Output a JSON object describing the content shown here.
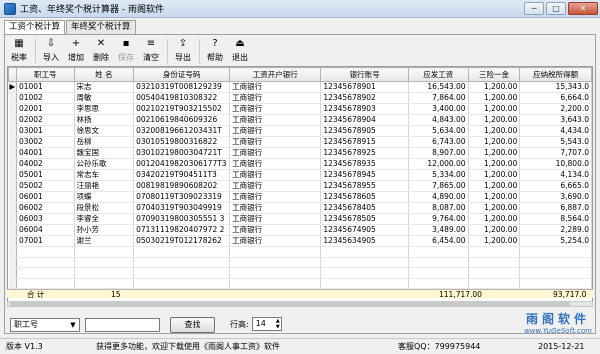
{
  "window": {
    "title": "工资、年终奖个税计算器 - 雨阁软件"
  },
  "tabs": [
    {
      "label": "工资个税计算",
      "active": true
    },
    {
      "label": "年终奖个税计算",
      "active": false
    }
  ],
  "toolbar": {
    "items": [
      {
        "label": "税率",
        "icon": "tax-rate-icon",
        "glyph": "▦",
        "disabled": false
      },
      {
        "label": "导入",
        "icon": "import-icon",
        "glyph": "⇩",
        "disabled": false
      },
      {
        "label": "增加",
        "icon": "add-icon",
        "glyph": "+",
        "disabled": false
      },
      {
        "label": "删除",
        "icon": "delete-icon",
        "glyph": "✕",
        "disabled": false
      },
      {
        "label": "保存",
        "icon": "save-icon",
        "glyph": "▪",
        "disabled": true
      },
      {
        "label": "清空",
        "icon": "clear-icon",
        "glyph": "≡",
        "disabled": false
      },
      {
        "label": "导出",
        "icon": "export-icon",
        "glyph": "⇪",
        "disabled": false
      },
      {
        "label": "帮助",
        "icon": "help-icon",
        "glyph": "?",
        "disabled": false
      },
      {
        "label": "退出",
        "icon": "exit-icon",
        "glyph": "⏏",
        "disabled": false
      }
    ]
  },
  "table": {
    "columns": [
      "职工号",
      "姓 名",
      "身份证号码",
      "工资开户银行",
      "银行账号",
      "应发工资",
      "三险一金",
      "应纳税所得额"
    ],
    "rows": [
      [
        "01001",
        "宋志",
        "03210319T008129239",
        "工商银行",
        "12345678901",
        "16,543.00",
        "1,200.00",
        "15,343.0"
      ],
      [
        "01002",
        "周敏",
        "00540419810308322",
        "工商银行",
        "12345678902",
        "7,864.00",
        "1,200.00",
        "6,664.0"
      ],
      [
        "02001",
        "李思思",
        "00210219T903215502",
        "工商银行",
        "12345678903",
        "3,400.00",
        "1,200.00",
        "2,200.0"
      ],
      [
        "02002",
        "林扬",
        "00210619840609326",
        "工商银行",
        "12345678904",
        "4,843.00",
        "1,200.00",
        "3,643.0"
      ],
      [
        "03001",
        "徐思文",
        "03200819661203431T",
        "工商银行",
        "12345678905",
        "5,634.00",
        "1,200.00",
        "4,434.0"
      ],
      [
        "03002",
        "岳柳",
        "03010519800316822",
        "工商银行",
        "12345678915",
        "6,743.00",
        "1,200.00",
        "5,543.0"
      ],
      [
        "04001",
        "魏宝国",
        "03010219800304721T",
        "工商银行",
        "12345678925",
        "8,907.00",
        "1,200.00",
        "7,707.0"
      ],
      [
        "04002",
        "公孙乐歌",
        "00120419820306177T3",
        "工商银行",
        "12345678935",
        "12,000.00",
        "1,200.00",
        "10,800.0"
      ],
      [
        "05001",
        "常志车",
        "03420219T904511T3",
        "工商银行",
        "12345678945",
        "5,334.00",
        "1,200.00",
        "4,134.0"
      ],
      [
        "05002",
        "汪丽艳",
        "00819819890608202",
        "工商银行",
        "12345678955",
        "7,865.00",
        "1,200.00",
        "6,665.0"
      ],
      [
        "06001",
        "项蝶",
        "07080119T309023319",
        "工商银行",
        "12345678605",
        "4,890.00",
        "1,200.00",
        "3,690.0"
      ],
      [
        "06002",
        "段景松",
        "07040319T903049919",
        "工商银行",
        "12345678405",
        "8,087.00",
        "1,200.00",
        "6,887.0"
      ],
      [
        "06003",
        "李睿全",
        "07090319800305551 3",
        "工商银行",
        "12345678505",
        "9,764.00",
        "1,200.00",
        "8,564.0"
      ],
      [
        "06004",
        "孙小芳",
        "07131119820407972 2",
        "工商银行",
        "12345674905",
        "3,489.00",
        "1,200.00",
        "2,289.0"
      ],
      [
        "07001",
        "谢兰",
        "05030219T012178262",
        "工商银行",
        "12345634905",
        "6,454.00",
        "1,200.00",
        "5,254.0"
      ]
    ],
    "totals": {
      "label": "合 计",
      "count": "15",
      "gross": "111,717.00",
      "taxable": "93,717.0"
    }
  },
  "search": {
    "field": "职工号",
    "input_value": "",
    "button": "查找",
    "row_height_label": "行高:",
    "row_height": "14"
  },
  "brand": {
    "name": "雨阁软件",
    "url": "www.YuGeSoft.com"
  },
  "status": {
    "version": "版本 V1.3",
    "info": "获得更多功能，欢迎下载使用《雨阁人事工资》软件",
    "qq": "客服QQ：799975944",
    "date": "2015-12-21"
  }
}
